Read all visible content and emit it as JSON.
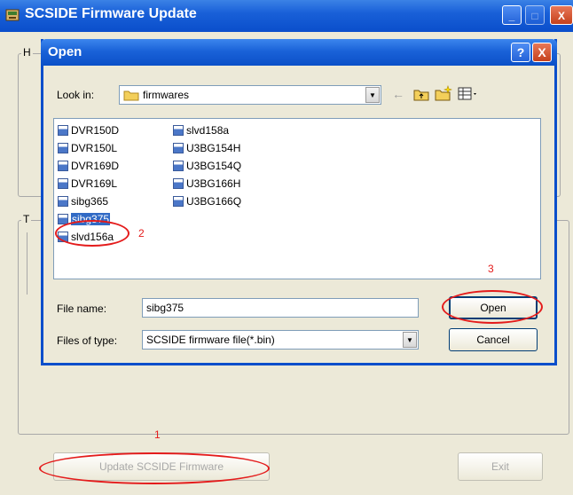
{
  "outer_window": {
    "title": "SCSIDE Firmware Update",
    "group1_label": "H",
    "group2_label": "T",
    "update_button": "Update SCSIDE Firmware",
    "exit_button": "Exit"
  },
  "dialog": {
    "title": "Open",
    "help_button": "?",
    "close_button": "X",
    "look_in_label": "Look in:",
    "look_in_value": "firmwares",
    "files": [
      {
        "name": "DVR150D"
      },
      {
        "name": "DVR150L"
      },
      {
        "name": "DVR169D"
      },
      {
        "name": "DVR169L"
      },
      {
        "name": "sibg365"
      },
      {
        "name": "sibg375",
        "selected": true
      },
      {
        "name": "slvd156a"
      },
      {
        "name": "slvd158a"
      },
      {
        "name": "U3BG154H"
      },
      {
        "name": "U3BG154Q"
      },
      {
        "name": "U3BG166H"
      },
      {
        "name": "U3BG166Q"
      }
    ],
    "file_name_label": "File name:",
    "file_name_value": "sibg375",
    "files_of_type_label": "Files of type:",
    "files_of_type_value": "SCSIDE firmware file(*.bin)",
    "open_button": "Open",
    "cancel_button": "Cancel"
  },
  "annotations": {
    "step1": "1",
    "step2": "2",
    "step3": "3",
    "color": "#e41b1b"
  },
  "colors": {
    "title_bar": "#0a4ecb",
    "selection": "#316ac5",
    "window_bg": "#ece9d8"
  }
}
